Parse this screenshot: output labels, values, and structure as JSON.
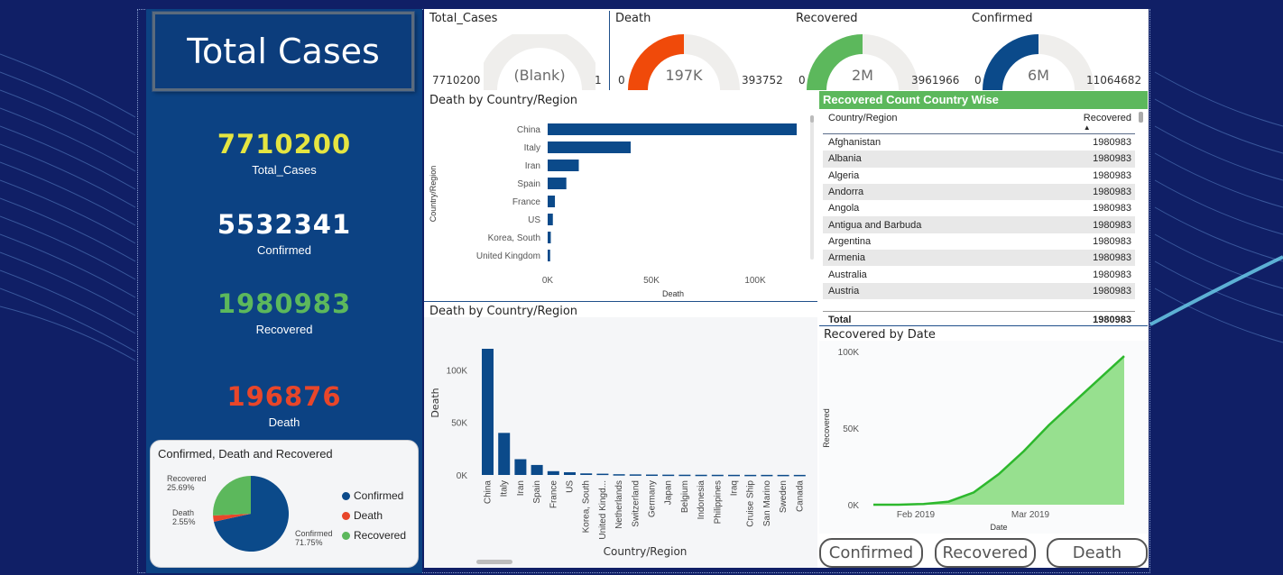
{
  "dashboard": {
    "title": "Total Cases",
    "kpis": [
      {
        "value": "7710200",
        "label": "Total_Cases",
        "color": "#e5e541"
      },
      {
        "value": "5532341",
        "label": "Confirmed",
        "color": "#ffffff"
      },
      {
        "value": "1980983",
        "label": "Recovered",
        "color": "#5cb85c"
      },
      {
        "value": "196876",
        "label": "Death",
        "color": "#e8462a"
      }
    ]
  },
  "gauges": [
    {
      "title": "Total_Cases",
      "min": "7710200",
      "max": "1",
      "value": "(Blank)",
      "color": "#efeeec",
      "fraction": 0
    },
    {
      "title": "Death",
      "min": "0",
      "max": "393752",
      "value": "197K",
      "color": "#f04a0a",
      "fraction": 0.5
    },
    {
      "title": "Recovered",
      "min": "0",
      "max": "3961966",
      "value": "2M",
      "color": "#5cb85c",
      "fraction": 0.5
    },
    {
      "title": "Confirmed",
      "min": "0",
      "max": "11064682",
      "value": "6M",
      "color": "#0b4a8a",
      "fraction": 0.5
    }
  ],
  "pie": {
    "title": "Confirmed, Death and Recovered",
    "legend": [
      "Confirmed",
      "Death",
      "Recovered"
    ],
    "colors": [
      "#0b4a8a",
      "#e8462a",
      "#5cb85c"
    ],
    "labels": {
      "recovered": "Recovered",
      "recovered_pct": "25.69%",
      "death": "Death",
      "death_pct": "2.55%",
      "confirmed": "Confirmed",
      "confirmed_pct": "71.75%"
    }
  },
  "table": {
    "title": "Recovered Count Country Wise",
    "col_country": "Country/Region",
    "col_recovered": "Recovered",
    "rows": [
      [
        "Afghanistan",
        "1980983"
      ],
      [
        "Albania",
        "1980983"
      ],
      [
        "Algeria",
        "1980983"
      ],
      [
        "Andorra",
        "1980983"
      ],
      [
        "Angola",
        "1980983"
      ],
      [
        "Antigua and Barbuda",
        "1980983"
      ],
      [
        "Argentina",
        "1980983"
      ],
      [
        "Armenia",
        "1980983"
      ],
      [
        "Australia",
        "1980983"
      ],
      [
        "Austria",
        "1980983"
      ]
    ],
    "total_label": "Total",
    "total_value": "1980983"
  },
  "buttons": {
    "confirmed": "Confirmed",
    "recovered": "Recovered",
    "death": "Death"
  },
  "chart_data": [
    {
      "type": "bar",
      "orientation": "horizontal",
      "title": "Death by Country/Region",
      "ylabel": "Country/Region",
      "xlabel": "Death",
      "categories": [
        "China",
        "Italy",
        "Iran",
        "Spain",
        "France",
        "US",
        "Korea, South",
        "United Kingdom"
      ],
      "values": [
        120000,
        40000,
        15000,
        9000,
        3500,
        2500,
        1500,
        1200
      ],
      "xticks": [
        "0K",
        "50K",
        "100K"
      ],
      "xlim": [
        0,
        120000
      ],
      "color": "#0b4a8a"
    },
    {
      "type": "bar",
      "title": "Death by Country/Region",
      "ylabel": "Death",
      "xlabel": "Country/Region",
      "categories": [
        "China",
        "Italy",
        "Iran",
        "Spain",
        "France",
        "US",
        "Korea, South",
        "United Kingd...",
        "Netherlands",
        "Switzerland",
        "Germany",
        "Japan",
        "Belgium",
        "Indonesia",
        "Philippines",
        "Iraq",
        "Cruise Ship",
        "San Marino",
        "Sweden",
        "Canada"
      ],
      "values": [
        120000,
        40000,
        15000,
        9500,
        3600,
        2600,
        1500,
        1200,
        700,
        550,
        400,
        300,
        250,
        200,
        180,
        150,
        120,
        100,
        90,
        80
      ],
      "yticks": [
        "0K",
        "50K",
        "100K"
      ],
      "ylim": [
        0,
        120000
      ],
      "color": "#0b4a8a"
    },
    {
      "type": "area",
      "title": "Recovered by Date",
      "ylabel": "Recovered",
      "xlabel": "Date",
      "xticks": [
        "Feb 2019",
        "Mar 2019"
      ],
      "yticks": [
        "0K",
        "50K",
        "100K"
      ],
      "ylim": [
        0,
        100000
      ],
      "x": [
        "Jan 22",
        "Jan 29",
        "Feb 5",
        "Feb 12",
        "Feb 19",
        "Feb 26",
        "Mar 4",
        "Mar 11",
        "Mar 18",
        "Mar 25",
        "Mar 30"
      ],
      "values": [
        0,
        0,
        500,
        2000,
        8000,
        20000,
        35000,
        52000,
        67000,
        82000,
        97000
      ],
      "color": "#2db82d",
      "fill": "#97e08f"
    }
  ]
}
